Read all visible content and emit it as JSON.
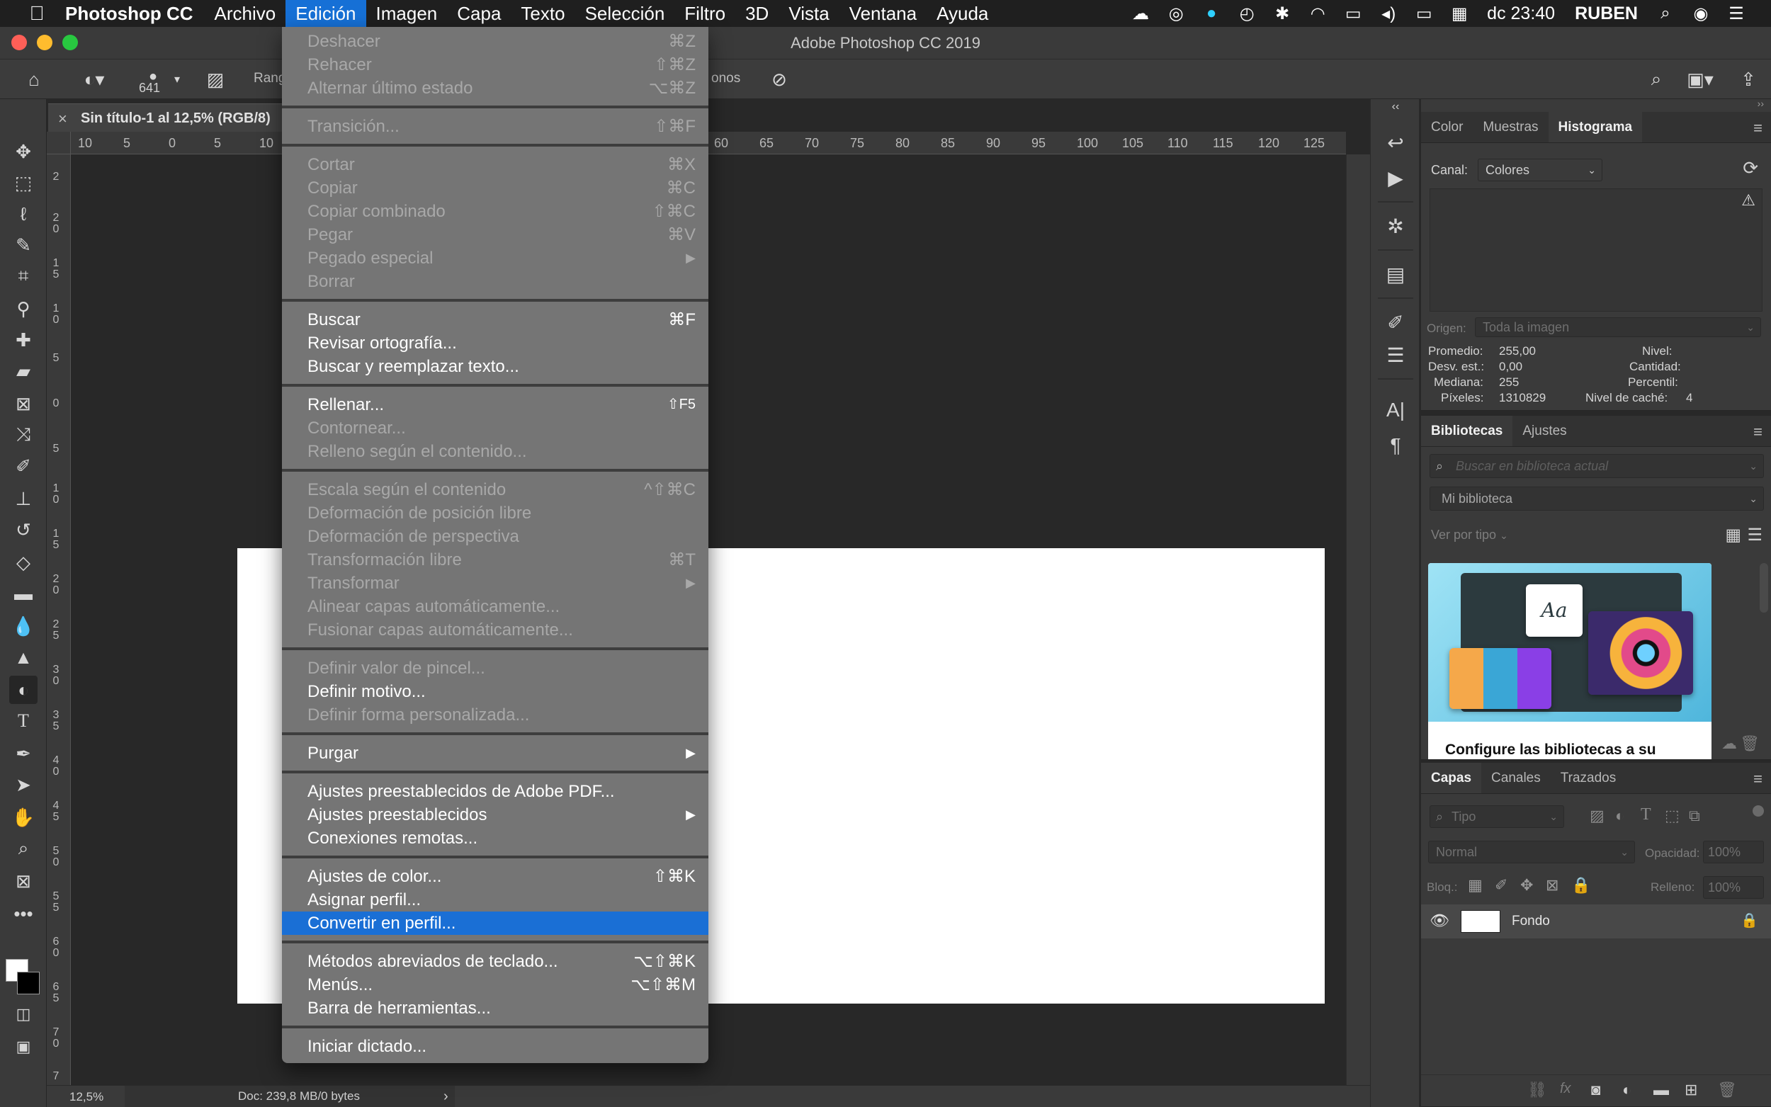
{
  "menubar": {
    "app_name": "Photoshop CC",
    "items": [
      "Archivo",
      "Edición",
      "Imagen",
      "Capa",
      "Texto",
      "Selección",
      "Filtro",
      "3D",
      "Vista",
      "Ventana",
      "Ayuda"
    ],
    "active_item": "Edición",
    "clock": "dc 23:40",
    "user": "RUBEN"
  },
  "window": {
    "title": "Adobe Photoshop CC 2019"
  },
  "options": {
    "brush_size": "641",
    "range_label": "Rang",
    "tones_label": "onos"
  },
  "document": {
    "tab_title": "Sin título-1 al 12,5% (RGB/8)",
    "ruler_h": [
      "10",
      "5",
      "0",
      "5",
      "10",
      "60",
      "65",
      "70",
      "75",
      "80",
      "85",
      "90",
      "95",
      "100",
      "105",
      "110",
      "115",
      "120",
      "125"
    ],
    "ruler_v": [
      "2",
      "2 0",
      "1 5",
      "1 0",
      "5",
      "0",
      "5",
      "1 0",
      "1 5",
      "2 0",
      "2 5",
      "3 0",
      "3 5",
      "4 0",
      "4 5",
      "5 0",
      "5 5",
      "6 0",
      "6 5",
      "7 0",
      "7"
    ],
    "zoom": "12,5%",
    "doc_info": "Doc: 239,8 MB/0 bytes",
    "canvas_color": "#ffffff"
  },
  "histogram_panel": {
    "tabs": [
      "Color",
      "Muestras",
      "Histograma"
    ],
    "active_tab": "Histograma",
    "channel_label": "Canal:",
    "channel_value": "Colores",
    "origin_label": "Origen:",
    "origin_value": "Toda la imagen",
    "stats": {
      "promedio_label": "Promedio:",
      "promedio": "255,00",
      "desv_label": "Desv. est.:",
      "desv": "0,00",
      "mediana_label": "Mediana:",
      "mediana": "255",
      "pixeles_label": "Píxeles:",
      "pixeles": "1310829",
      "nivel_label": "Nivel:",
      "cantidad_label": "Cantidad:",
      "percentil_label": "Percentil:",
      "cache_label": "Nivel de caché:",
      "cache": "4"
    }
  },
  "libraries_panel": {
    "tabs": [
      "Bibliotecas",
      "Ajustes"
    ],
    "active_tab": "Bibliotecas",
    "search_placeholder": "Buscar en biblioteca actual",
    "library_name": "Mi biblioteca",
    "view_by": "Ver por tipo",
    "promo_title": "Configure las bibliotecas a su",
    "promo_sample_text": "Aa"
  },
  "layers_panel": {
    "tabs": [
      "Capas",
      "Canales",
      "Trazados"
    ],
    "active_tab": "Capas",
    "filter_placeholder": "Tipo",
    "blend_mode": "Normal",
    "opacity_label": "Opacidad:",
    "opacity_value": "100%",
    "lock_label": "Bloq.:",
    "fill_label": "Relleno:",
    "fill_value": "100%",
    "layers": [
      {
        "name": "Fondo",
        "visible": true,
        "locked": true
      }
    ]
  },
  "edit_menu": {
    "items": [
      {
        "label": "Deshacer",
        "shortcut": "⌘Z",
        "enabled": false
      },
      {
        "label": "Rehacer",
        "shortcut": "⇧⌘Z",
        "enabled": false
      },
      {
        "label": "Alternar último estado",
        "shortcut": "⌥⌘Z",
        "enabled": false
      },
      {
        "label": "Transición...",
        "shortcut": "⇧⌘F",
        "enabled": false
      },
      {
        "label": "Cortar",
        "shortcut": "⌘X",
        "enabled": false
      },
      {
        "label": "Copiar",
        "shortcut": "⌘C",
        "enabled": false
      },
      {
        "label": "Copiar combinado",
        "shortcut": "⇧⌘C",
        "enabled": false
      },
      {
        "label": "Pegar",
        "shortcut": "⌘V",
        "enabled": false
      },
      {
        "label": "Pegado especial",
        "shortcut": "▶",
        "enabled": false
      },
      {
        "label": "Borrar",
        "shortcut": "",
        "enabled": false
      },
      {
        "label": "Buscar",
        "shortcut": "⌘F",
        "enabled": true
      },
      {
        "label": "Revisar ortografía...",
        "shortcut": "",
        "enabled": true
      },
      {
        "label": "Buscar y reemplazar texto...",
        "shortcut": "",
        "enabled": true
      },
      {
        "label": "Rellenar...",
        "shortcut": "⇧F5",
        "enabled": true
      },
      {
        "label": "Contornear...",
        "shortcut": "",
        "enabled": false
      },
      {
        "label": "Relleno según el contenido...",
        "shortcut": "",
        "enabled": false
      },
      {
        "label": "Escala según el contenido",
        "shortcut": "^⇧⌘C",
        "enabled": false
      },
      {
        "label": "Deformación de posición libre",
        "shortcut": "",
        "enabled": false
      },
      {
        "label": "Deformación de perspectiva",
        "shortcut": "",
        "enabled": false
      },
      {
        "label": "Transformación libre",
        "shortcut": "⌘T",
        "enabled": false
      },
      {
        "label": "Transformar",
        "shortcut": "▶",
        "enabled": false
      },
      {
        "label": "Alinear capas automáticamente...",
        "shortcut": "",
        "enabled": false
      },
      {
        "label": "Fusionar capas automáticamente...",
        "shortcut": "",
        "enabled": false
      },
      {
        "label": "Definir valor de pincel...",
        "shortcut": "",
        "enabled": false
      },
      {
        "label": "Definir motivo...",
        "shortcut": "",
        "enabled": true
      },
      {
        "label": "Definir forma personalizada...",
        "shortcut": "",
        "enabled": false
      },
      {
        "label": "Purgar",
        "shortcut": "▶",
        "enabled": true
      },
      {
        "label": "Ajustes preestablecidos de Adobe PDF...",
        "shortcut": "",
        "enabled": true
      },
      {
        "label": "Ajustes preestablecidos",
        "shortcut": "▶",
        "enabled": true
      },
      {
        "label": "Conexiones remotas...",
        "shortcut": "",
        "enabled": true
      },
      {
        "label": "Ajustes de color...",
        "shortcut": "⇧⌘K",
        "enabled": true
      },
      {
        "label": "Asignar perfil...",
        "shortcut": "",
        "enabled": true
      },
      {
        "label": "Convertir en perfil...",
        "shortcut": "",
        "enabled": true,
        "highlighted": true
      },
      {
        "label": "Métodos abreviados de teclado...",
        "shortcut": "⌥⇧⌘K",
        "enabled": true
      },
      {
        "label": "Menús...",
        "shortcut": "⌥⇧⌘M",
        "enabled": true
      },
      {
        "label": "Barra de herramientas...",
        "shortcut": "",
        "enabled": true
      },
      {
        "label": "Iniciar dictado...",
        "shortcut": "",
        "enabled": true
      }
    ]
  },
  "colors": {
    "menu_highlight": "#1a6fd5",
    "menu_bg": "#757575",
    "app_bg": "#282828",
    "panel_bg": "#3a3a3a",
    "traffic_red": "#fe5f57",
    "traffic_yellow": "#febc2e",
    "traffic_green": "#28c840"
  },
  "icons": {
    "toolbar": [
      "move-icon",
      "marquee-icon",
      "lasso-icon",
      "quick-select-icon",
      "crop-icon",
      "eyedropper-icon",
      "healing-brush-icon",
      "patch-icon",
      "frame-icon",
      "content-aware-move-icon",
      "brush-icon",
      "stamp-icon",
      "history-brush-icon",
      "eraser-icon",
      "gradient-icon",
      "blur-icon",
      "sharpen-icon",
      "dodge-icon",
      "type-icon",
      "pen-icon",
      "path-select-icon",
      "hand-icon",
      "zoom-icon",
      "artboard-icon",
      "more-tools-icon"
    ]
  }
}
